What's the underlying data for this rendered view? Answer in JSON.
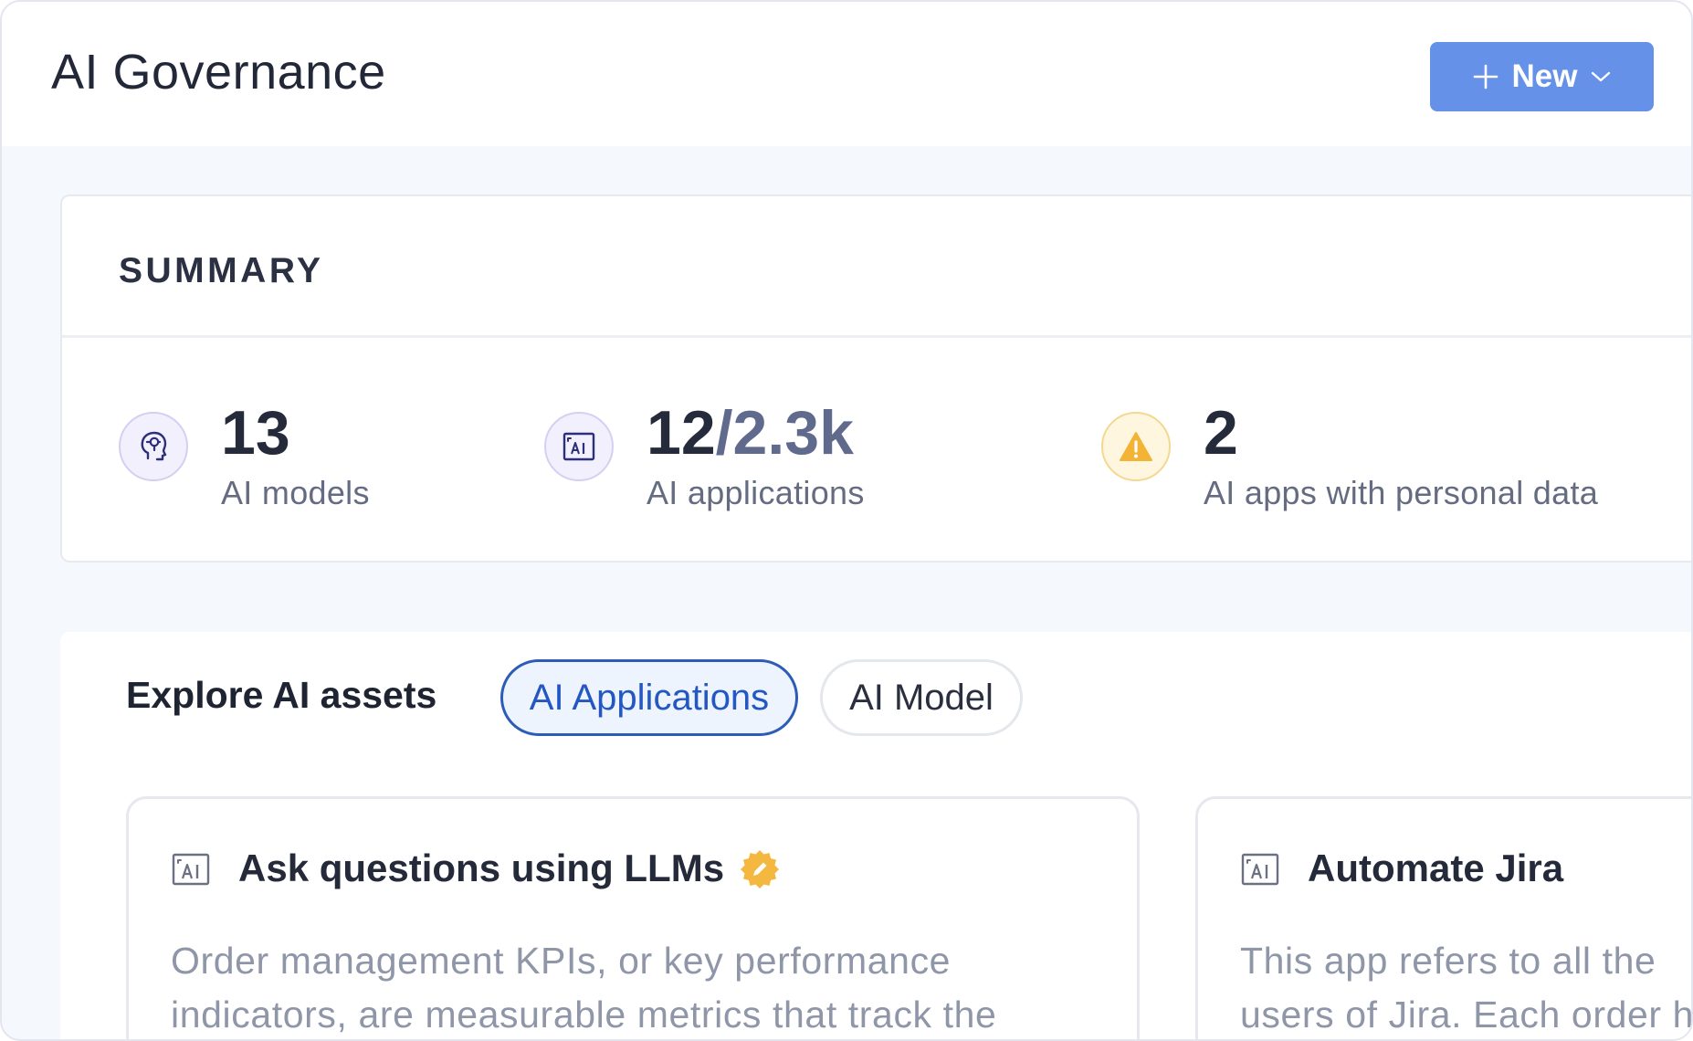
{
  "header": {
    "title": "AI Governance",
    "new_button_label": "New"
  },
  "summary": {
    "title": "SUMMARY",
    "stats": [
      {
        "value": "13",
        "value_suffix": "",
        "label": "AI models",
        "icon": "brain-head-icon"
      },
      {
        "value": "12",
        "value_suffix": "/2.3k",
        "label": "AI applications",
        "icon": "ai-app-icon"
      },
      {
        "value": "2",
        "value_suffix": "",
        "label": "AI apps with personal data",
        "icon": "warning-icon"
      }
    ]
  },
  "explore": {
    "title": "Explore AI assets",
    "tabs": [
      {
        "label": "AI Applications",
        "active": true
      },
      {
        "label": "AI Model",
        "active": false
      }
    ],
    "cards": [
      {
        "title": "Ask questions using LLMs",
        "certified": true,
        "description_lines": [
          "Order management KPIs, or key performance",
          "indicators, are measurable metrics that track the"
        ]
      },
      {
        "title": "Automate Jira",
        "certified": false,
        "description_lines": [
          "This app refers to all the",
          "users of Jira. Each order h"
        ]
      }
    ]
  },
  "colors": {
    "primary_button": "#6591e8",
    "active_tab_border": "#2c5bb8",
    "warning": "#f3b335",
    "certified_badge": "#f4b740"
  }
}
